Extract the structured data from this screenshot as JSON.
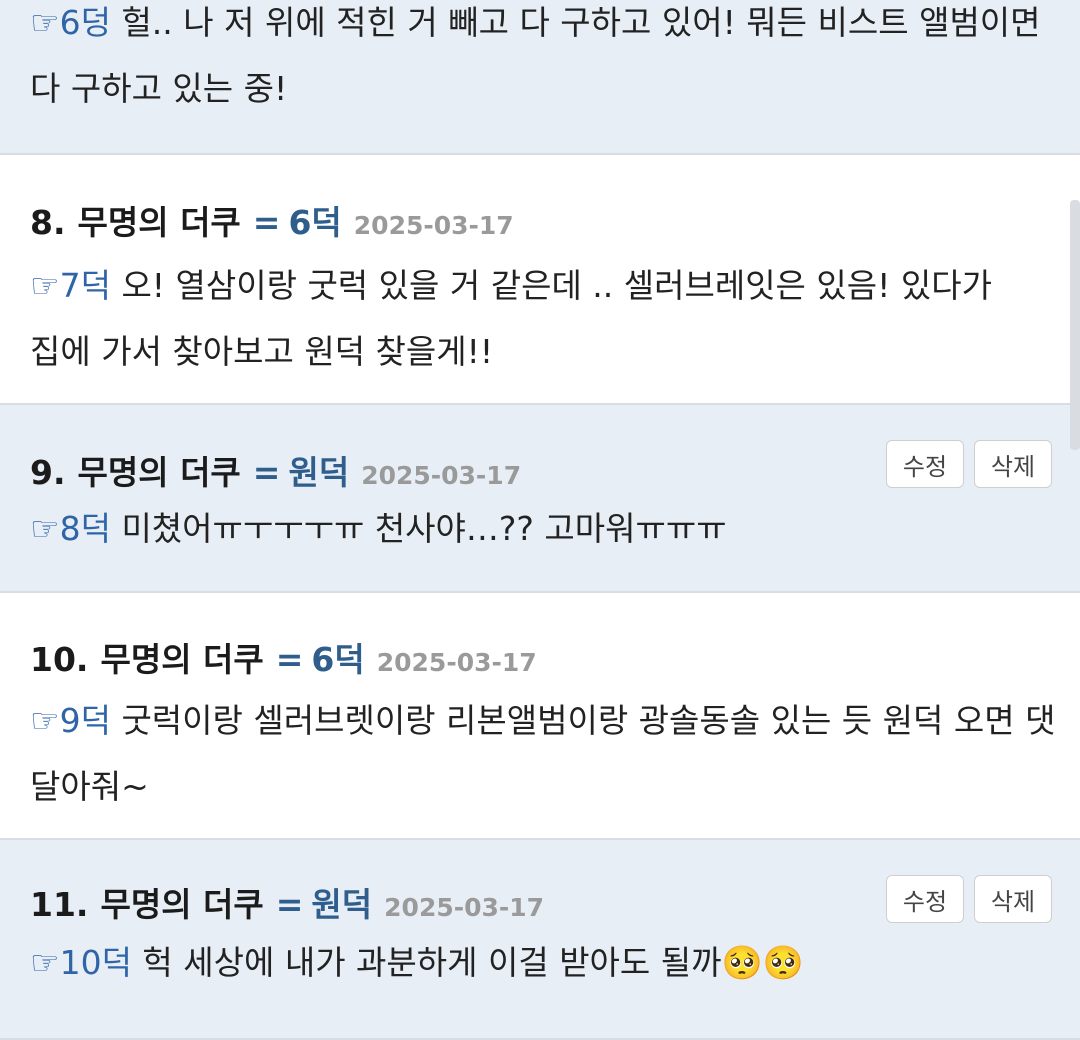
{
  "comments": [
    {
      "variant": "mine",
      "number": "",
      "author": "",
      "poster": "",
      "date": "",
      "reply_ref": "☞6덩",
      "text": " 헐.. 나 저 위에 적힌 거 빼고 다 구하고 있어! 뭐든 비스트 앨범이면 다 구하고 있는 중!",
      "buttons": []
    },
    {
      "variant": "other",
      "number": "8.",
      "author": "무명의 더쿠",
      "poster": "6덕",
      "date": "2025-03-17",
      "reply_ref": "☞7덕",
      "text": " 오! 열삼이랑 굿럭 있을 거 같은데 .. 셀러브레잇은 있음! 있다가 집에 가서 찾아보고 원덕 찾을게!!",
      "buttons": []
    },
    {
      "variant": "mine",
      "number": "9.",
      "author": "무명의 더쿠",
      "poster": "원덕",
      "date": "2025-03-17",
      "reply_ref": "☞8덕",
      "text": " 미쳤어ㅠㅜㅜㅜㅠ 천사야…?? 고마워ㅠㅠㅠ",
      "buttons": [
        "수정",
        "삭제"
      ]
    },
    {
      "variant": "other",
      "number": "10.",
      "author": "무명의 더쿠",
      "poster": "6덕",
      "date": "2025-03-17",
      "reply_ref": "☞9덕",
      "text": " 굿럭이랑 셀러브렛이랑 리본앨범이랑 광솔동솔 있는 듯 원덕 오면 댓 달아줘~",
      "buttons": []
    },
    {
      "variant": "mine",
      "number": "11.",
      "author": "무명의 더쿠",
      "poster": "원덕",
      "date": "2025-03-17",
      "reply_ref": "☞10덕",
      "text": " 헉 세상에 내가 과분하게 이걸 받아도 될까🥺🥺",
      "buttons": [
        "수정",
        "삭제"
      ]
    }
  ],
  "labels": {
    "eq": "="
  },
  "colors": {
    "mine_bg": "#e7eef6",
    "other_bg": "#ffffff",
    "poster": "#2f5d8c",
    "reply_ref": "#2f65a7",
    "date": "#9a9a9a"
  }
}
